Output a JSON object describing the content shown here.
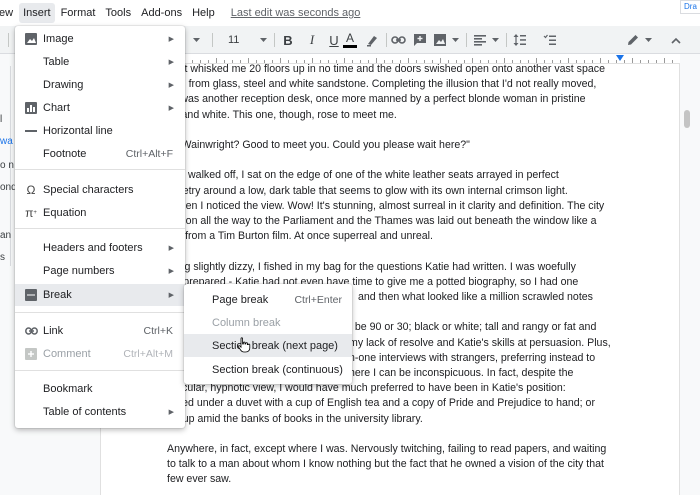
{
  "menubar": {
    "items": [
      "ew",
      "Insert",
      "Format",
      "Tools",
      "Add-ons",
      "Help"
    ],
    "last_edit": "Last edit was seconds ago",
    "share_stub": "Dra"
  },
  "toolbar": {
    "font_size": "11",
    "bold": "B",
    "italic": "I",
    "underline": "U",
    "text_color": "A"
  },
  "left_outline": {
    "fragments": [
      "l",
      "wa",
      "o n",
      "ond",
      "an",
      "s"
    ]
  },
  "insert_menu": {
    "items": [
      {
        "label": "Image",
        "icon": "image-icon",
        "submenu": true
      },
      {
        "label": "Table",
        "submenu": true
      },
      {
        "label": "Drawing",
        "submenu": true
      },
      {
        "label": "Chart",
        "icon": "chart-icon",
        "submenu": true
      },
      {
        "label": "Horizontal line",
        "icon": "horizontal-line-icon"
      },
      {
        "label": "Footnote",
        "shortcut": "Ctrl+Alt+F"
      },
      {
        "label": "Special characters",
        "icon": "omega-icon"
      },
      {
        "label": "Equation",
        "icon": "pi-icon"
      },
      {
        "label": "Headers and footers",
        "submenu": true
      },
      {
        "label": "Page numbers",
        "submenu": true
      },
      {
        "label": "Break",
        "icon": "break-icon",
        "submenu": true,
        "highlighted": true
      },
      {
        "label": "Link",
        "icon": "link-icon",
        "shortcut": "Ctrl+K"
      },
      {
        "label": "Comment",
        "icon": "comment-icon",
        "shortcut": "Ctrl+Alt+M",
        "disabled": true
      },
      {
        "label": "Bookmark"
      },
      {
        "label": "Table of contents",
        "submenu": true
      }
    ]
  },
  "break_submenu": {
    "items": [
      {
        "label": "Page break",
        "shortcut": "Ctrl+Enter"
      },
      {
        "label": "Column break",
        "disabled": true
      },
      {
        "label": "Section break (next page)",
        "highlighted": true
      },
      {
        "label": "Section break (continuous)"
      }
    ]
  },
  "document": {
    "lines": [
      "e lift whisked me 20 floors up in no time and the doors swished open onto another vast space",
      "fted from glass, steel and white sandstone. Completing the illusion that I'd not really moved,",
      "re was another reception desk, once more manned by a perfect blonde woman in pristine",
      "ck and white. This one, though, rose to meet me.",
      "",
      "ss Wainwright? Good to meet you. Could you please wait here?\"",
      "",
      "she walked off, I sat on the edge of one of the white leather seats arrayed in perfect",
      "nmetry around a low, dark table that seems to glow with its own internal crimson light.",
      "d then I noticed the view. Wow! It's stunning, almost surreal in it clarity and definition. The city",
      "ondon all the way to the Parliament and the Thames was laid out beneath the window like a",
      "del from a Tim Burton film. At once superreal and unreal.",
      "",
      "eling slightly dizzy, I fished in my bag for the questions Katie had written. I was woefully",
      "derprepared - Katie had not even have time to give me a potted biography, so I had one",
      "and then what looked like a million scrawled notes",
      "",
      "t be 90 or 30; black or white; tall and rangy or fat and",
      "my lack of resolve and Katie's skills at persuasion. Plus,",
      "n-one interviews with strangers, preferring instead to",
      "here I can be inconspicuous. In fact, despite the",
      "ctacular, hypnotic view, I would have much preferred to have been in Katie's position:",
      "ggled under a duvet with a cup of English tea and a copy of Pride and Prejudice to hand; or",
      "ed up amid the banks of books in the university library.",
      "",
      "Anywhere, in fact, except where I was. Nervously twitching, failing to read papers, and waiting",
      "to talk to a man about whom I know nothing but the fact that he owned a vision of the city that",
      "few ever saw."
    ]
  },
  "colors": {
    "accent": "#1a73e8",
    "menu_highlight": "#e8eaed",
    "disabled_text": "#9aa0a6"
  }
}
